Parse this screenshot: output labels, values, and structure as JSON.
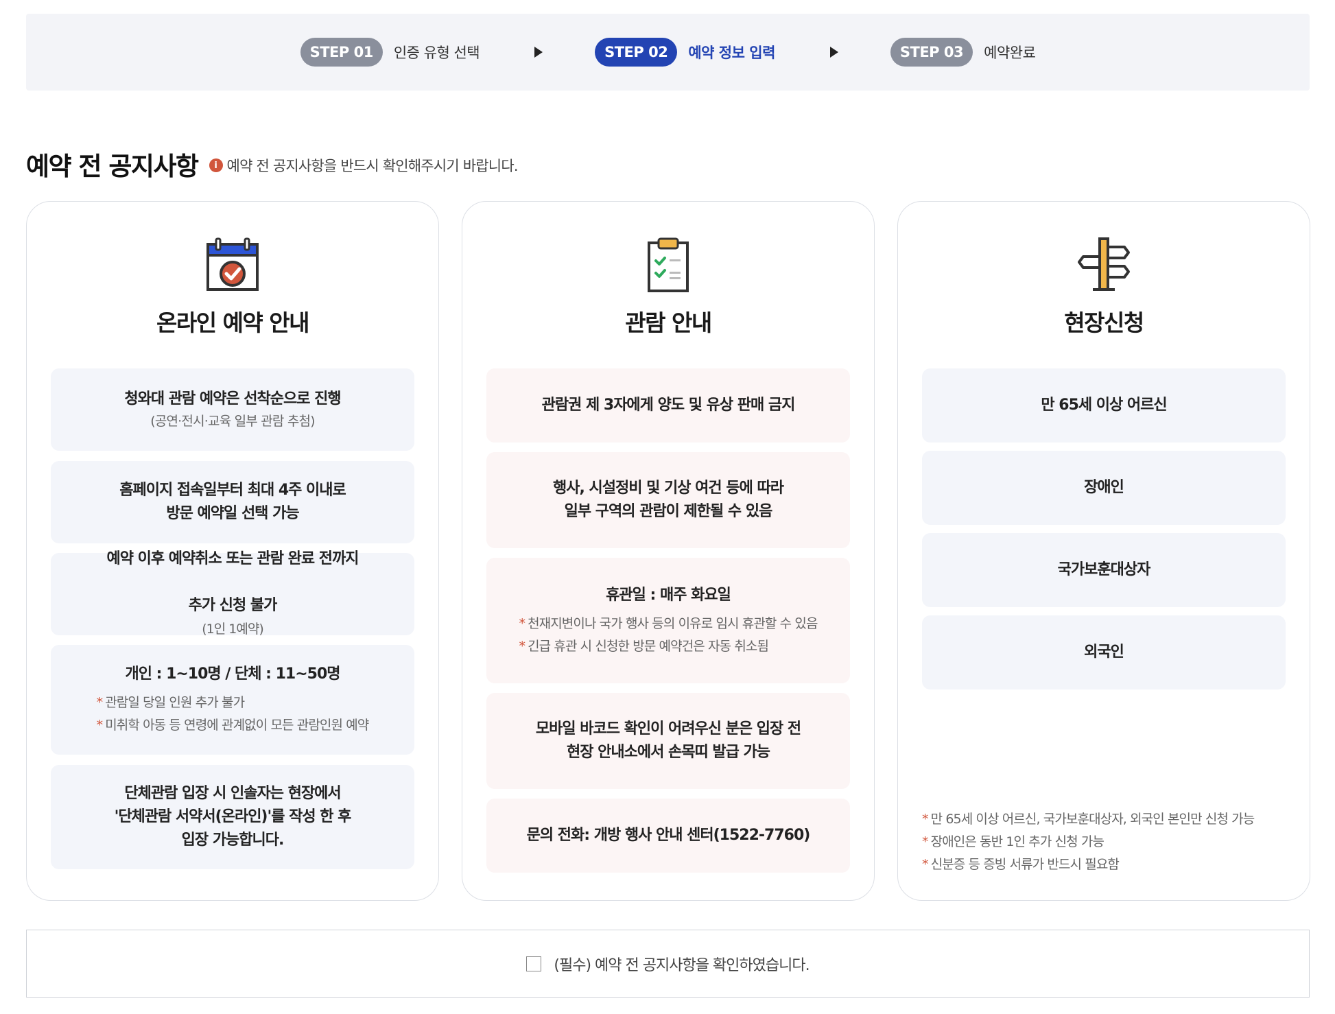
{
  "steps": [
    {
      "badge": "STEP 01",
      "label": "인증 유형 선택"
    },
    {
      "badge": "STEP 02",
      "label": "예약 정보 입력"
    },
    {
      "badge": "STEP 03",
      "label": "예약완료"
    }
  ],
  "title": "예약 전 공지사항",
  "title_note": "예약 전 공지사항을 반드시 확인해주시기 바랍니다.",
  "info_icon": "i",
  "colors": {
    "accent": "#2344b3",
    "step_inactive": "#8a8f9c",
    "warning": "#d1563c"
  },
  "cards": [
    {
      "icon": "calendar-check-icon",
      "title": "온라인 예약 안내",
      "items": [
        {
          "main": "청와대 관람 예약은 선착순으로 진행",
          "sub": "(공연·전시·교육 일부 관람 추첨)"
        },
        {
          "main": "홈페이지 접속일부터 최대 4주 이내로\n방문 예약일 선택 가능"
        },
        {
          "main": "예약 이후 예약취소 또는 관람 완료 전까지",
          "main2": "추가 신청 불가",
          "inline_sub": "(1인 1예약)"
        },
        {
          "main": "개인 : 1~10명 / 단체 : 11~50명",
          "notes": [
            "관람일 당일 인원 추가 불가",
            "미취학 아동 등 연령에 관계없이 모든 관람인원 예약"
          ]
        },
        {
          "main": "단체관람 입장 시 인솔자는 현장에서\n'단체관람 서약서(온라인)'를 작성 한 후\n입장 가능합니다."
        }
      ]
    },
    {
      "icon": "clipboard-checklist-icon",
      "title": "관람 안내",
      "items": [
        {
          "main": "관람권 제 3자에게 양도 및 유상 판매 금지"
        },
        {
          "main": "행사, 시설정비 및 기상 여건 등에 따라\n일부 구역의 관람이 제한될 수 있음"
        },
        {
          "main": "휴관일 : 매주 화요일",
          "notes": [
            "천재지변이나 국가 행사 등의 이유로 임시 휴관할 수 있음",
            "긴급 휴관 시 신청한 방문 예약건은 자동 취소됨"
          ]
        },
        {
          "main": "모바일 바코드 확인이 어려우신 분은 입장 전\n현장 안내소에서 손목띠 발급 가능"
        },
        {
          "main": "문의 전화: 개방 행사 안내 센터(1522-7760)"
        }
      ]
    },
    {
      "icon": "signpost-icon",
      "title": "현장신청",
      "items": [
        {
          "main": "만 65세 이상 어르신"
        },
        {
          "main": "장애인"
        },
        {
          "main": "국가보훈대상자"
        },
        {
          "main": "외국인"
        }
      ],
      "notes": [
        "만 65세 이상 어르신, 국가보훈대상자, 외국인 본인만 신청 가능",
        "장애인은 동반 1인 추가 신청 가능",
        "신분증 등 증빙 서류가 반드시 필요함"
      ]
    }
  ],
  "note_marker": "*",
  "agree_label": "(필수) 예약 전 공지사항을 확인하였습니다."
}
